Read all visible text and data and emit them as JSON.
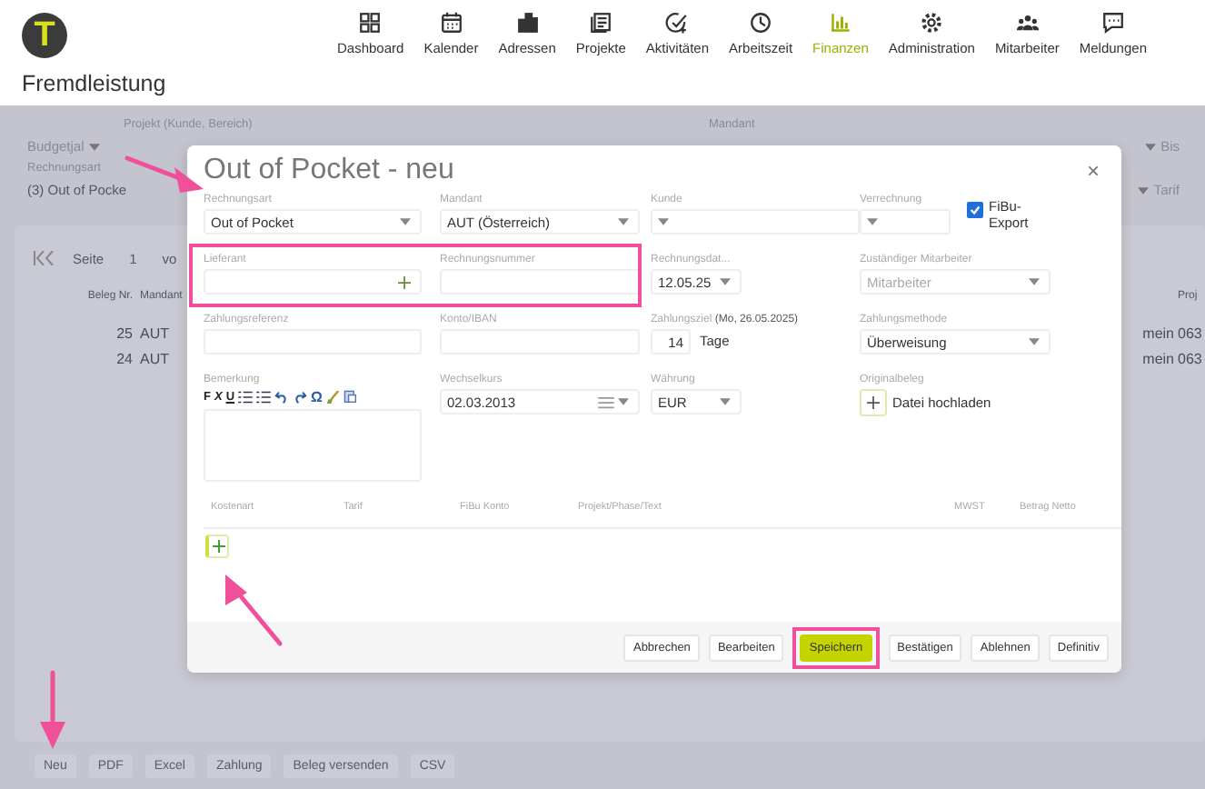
{
  "logo": {
    "letter": "T"
  },
  "nav": [
    {
      "label": "Dashboard",
      "selected": false
    },
    {
      "label": "Kalender",
      "selected": false
    },
    {
      "label": "Adressen",
      "selected": false
    },
    {
      "label": "Projekte",
      "selected": false
    },
    {
      "label": "Aktivitäten",
      "selected": false
    },
    {
      "label": "Arbeitszeit",
      "selected": false
    },
    {
      "label": "Finanzen",
      "selected": true
    },
    {
      "label": "Administration",
      "selected": false
    },
    {
      "label": "Mitarbeiter",
      "selected": false
    },
    {
      "label": "Meldungen",
      "selected": false
    }
  ],
  "page_title": "Fremdleistung",
  "filters": {
    "budget": "Budgetjal",
    "projekt_label": "Projekt (Kunde, Bereich)",
    "mandant_label": "Mandant",
    "rechnungsart_label": "Rechnungsart",
    "rechnungsart_value": "(3) Out of Pocke",
    "right_top": "Bis",
    "right_bottom": "Tarif"
  },
  "pager": {
    "label": "Seite",
    "page": "1",
    "of": "vo"
  },
  "table": {
    "columns": [
      "Beleg Nr.",
      "Mandant"
    ],
    "right_column": "Proj",
    "rows": [
      {
        "nr": "25",
        "mandant": "AUT",
        "column_3": "mein",
        "column_4": "063"
      },
      {
        "nr": "24",
        "mandant": "AUT",
        "column_3": "mein",
        "column_4": "063"
      }
    ]
  },
  "bottom_buttons": [
    "Neu",
    "PDF",
    "Excel",
    "Zahlung",
    "Beleg versenden",
    "CSV"
  ],
  "dialog": {
    "title": "Out of Pocket - neu",
    "close": "×",
    "rows": [
      {
        "fields": [
          {
            "label": "Rechnungsart",
            "kind": "select",
            "value": "Out of Pocket"
          },
          {
            "label": "Mandant",
            "kind": "select",
            "value": "AUT (Österreich)"
          },
          {
            "label": "Kunde",
            "kind": "select"
          },
          {
            "label": "Verrechnung",
            "kind": "select",
            "checkbox": {
              "label": "FiBu-Export",
              "checked": true
            }
          }
        ]
      },
      {
        "fields": [
          {
            "label": "Lieferant",
            "kind": "lookup"
          },
          {
            "label": "Rechnungsnummer",
            "kind": "input"
          },
          {
            "label": "Rechnungsdat...",
            "kind": "select",
            "value": "12.05.25"
          },
          {
            "label": "Zuständiger Mitarbeiter",
            "kind": "select",
            "placeholder": "Mitarbeiter"
          }
        ]
      },
      {
        "fields": [
          {
            "label": "Zahlungsreferenz",
            "kind": "input"
          },
          {
            "label": "Konto/IBAN",
            "kind": "input"
          },
          {
            "label": "Zahlungsziel **(Mo, 26.05.2025)**",
            "kind": "number_unit",
            "value": "14",
            "unit": "Tage"
          },
          {
            "label": "Zahlungsmethode",
            "kind": "select",
            "value": "Überweisung"
          }
        ]
      },
      {
        "fields": [
          {
            "label": "Bemerkung",
            "kind": "editor",
            "tools": [
              {
                "kind": "text",
                "text": "F"
              },
              {
                "kind": "text",
                "text": "X"
              },
              {
                "kind": "text",
                "text": "U"
              },
              {
                "kind": "numbered"
              },
              {
                "kind": "bullets"
              },
              {
                "kind": "undo"
              },
              {
                "kind": "redo"
              },
              {
                "kind": "text",
                "text": "Ω"
              },
              {
                "kind": "brush"
              },
              {
                "kind": "paste"
              }
            ]
          },
          {
            "label": "Wechselkurs",
            "kind": "rate",
            "value": "02.03.2013"
          },
          {
            "label": "Währung",
            "kind": "select",
            "value": "EUR"
          },
          {
            "label": "Originalbeleg",
            "kind": "upload",
            "button": "Datei hochladen"
          }
        ]
      }
    ],
    "columns": [
      "Kostenart",
      "Tarif",
      "FiBu Konto",
      "Projekt/Phase/Text",
      "MWST",
      "Betrag Netto"
    ],
    "buttons": [
      {
        "label": "Abbrechen",
        "kind": "default"
      },
      {
        "label": "Bearbeiten",
        "kind": "default"
      },
      {
        "label": "Speichern",
        "kind": "primary"
      },
      {
        "label": "Bestätigen",
        "kind": "default"
      },
      {
        "label": "Ablehnen",
        "kind": "default"
      },
      {
        "label": "Definitiv",
        "kind": "default"
      }
    ]
  }
}
